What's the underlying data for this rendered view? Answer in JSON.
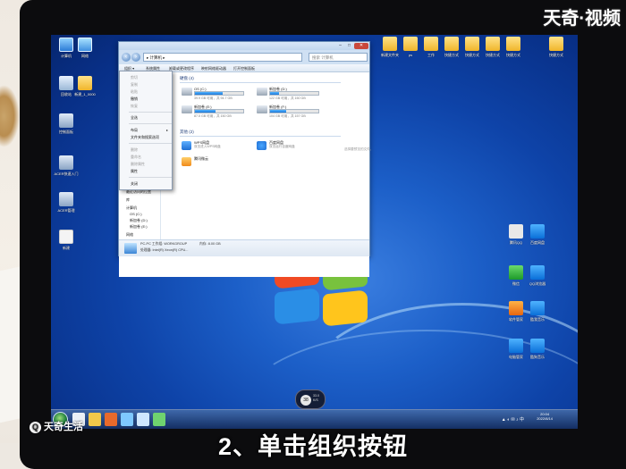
{
  "overlay": {
    "caption": "2、单击组织按钮",
    "watermark_top": "天奇·视频",
    "watermark_bottom": "天奇生活"
  },
  "desktop": {
    "icons_left": [
      {
        "label": "计算机",
        "icon": "computer-icon"
      },
      {
        "label": "网络",
        "icon": "network-icon"
      },
      {
        "label": "回收站",
        "icon": "recycle-bin-icon"
      },
      {
        "label": "新建_1_0000",
        "icon": "folder-icon"
      },
      {
        "label": "控制面板",
        "icon": "control-panel-icon"
      },
      {
        "label": "ACER快速入门",
        "icon": "app-icon"
      },
      {
        "label": "ACER管理",
        "icon": "app-icon"
      },
      {
        "label": "新建",
        "icon": "document-icon"
      }
    ],
    "icons_top_right": [
      {
        "label": "新建文件夹",
        "icon": "folder-icon"
      },
      {
        "label": "ps",
        "icon": "folder-icon"
      },
      {
        "label": "工作",
        "icon": "folder-icon"
      },
      {
        "label": "快捷方式",
        "icon": "folder-icon"
      },
      {
        "label": "快捷方式",
        "icon": "folder-icon"
      },
      {
        "label": "快捷方式",
        "icon": "folder-icon"
      },
      {
        "label": "快捷方式",
        "icon": "folder-icon"
      },
      {
        "label": "快捷方式",
        "icon": "folder-icon"
      }
    ],
    "icons_right": [
      {
        "label": "腾讯QQ",
        "icon": "qq-icon"
      },
      {
        "label": "百度网盘",
        "icon": "cloud-icon"
      },
      {
        "label": "微信",
        "icon": "wechat-icon"
      },
      {
        "label": "QQ浏览器",
        "icon": "browser-icon"
      },
      {
        "label": "软件管家",
        "icon": "app-store-icon"
      },
      {
        "label": "酷我音乐",
        "icon": "music-icon"
      },
      {
        "label": "电脑管家",
        "icon": "shield-icon"
      },
      {
        "label": "酷狗音乐",
        "icon": "music-icon"
      }
    ]
  },
  "window": {
    "address": "▸ 计算机 ▸",
    "search_placeholder": "搜索 计算机",
    "toolbar": [
      "组织 ▾",
      "系统属性",
      "卸载或更改程序",
      "映射网络驱动器",
      "打开控制面板"
    ],
    "navpane": [
      "收藏夹",
      "下载",
      "桌面",
      "最近访问的位置",
      "库",
      "计算机",
      "OS (C:)",
      "新加卷 (D:)",
      "新加卷 (E:)",
      "网络"
    ],
    "groups": {
      "hard_drives": "硬盘 (4)",
      "other_devices": "其他 (2)"
    },
    "drives": [
      {
        "name": "OS (C:)",
        "size": "39.9 GB 可用，共 94.7 GB",
        "used": 0.58
      },
      {
        "name": "新加卷 (D:)",
        "size": "122 GB 可用，共 150 GB",
        "used": 0.19
      },
      {
        "name": "新加卷 (E:)",
        "size": "87.5 GB 可用，共 150 GB",
        "used": 0.42
      },
      {
        "name": "新加卷 (F:)",
        "size": "104 GB 可用，共 157 GB",
        "used": 0.34
      }
    ],
    "other_devices": [
      {
        "name": "WPS网盘",
        "sub": "双击进入WPS网盘",
        "icon": "wps-cloud-icon"
      },
      {
        "name": "百度网盘",
        "sub": "双击运行百度网盘",
        "icon": "baidu-cloud-icon"
      },
      {
        "name": "腾讯微云",
        "sub": "",
        "icon": "weiyun-icon"
      }
    ],
    "preview_hint": "选择要预览的文件。",
    "details": {
      "name": "PC-PC 工作组: WORKGROUP",
      "memory": "内存: 8.00 GB",
      "cpu": "处理器: Intel(R) Xeon(R) CPU..."
    }
  },
  "organize_menu": {
    "items": [
      {
        "label": "剪切",
        "disabled": true
      },
      {
        "label": "复制",
        "disabled": true
      },
      {
        "label": "粘贴",
        "disabled": true
      },
      {
        "label": "撤销",
        "disabled": false
      },
      {
        "label": "恢复",
        "disabled": true
      },
      {
        "label": "全选",
        "disabled": false
      },
      {
        "label": "布局",
        "disabled": false,
        "submenu": true
      },
      {
        "label": "文件夹和搜索选项",
        "disabled": false
      },
      {
        "label": "删除",
        "disabled": true
      },
      {
        "label": "重命名",
        "disabled": true
      },
      {
        "label": "删除属性",
        "disabled": true
      },
      {
        "label": "属性",
        "disabled": false
      },
      {
        "label": "关闭",
        "disabled": false
      }
    ]
  },
  "taskbar": {
    "time": "20:04",
    "date": "2022/8/14",
    "tray": "▲ ◐ ✉ ♪ 中"
  },
  "gadget": {
    "value": "38",
    "line1": "33.0",
    "line2": "K/S"
  }
}
